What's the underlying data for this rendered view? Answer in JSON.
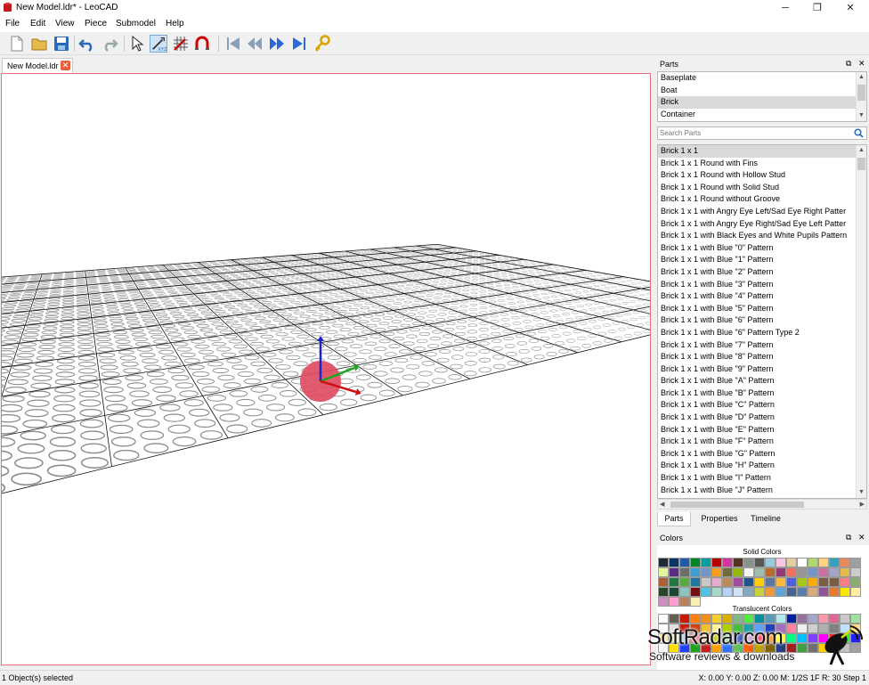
{
  "window": {
    "title": "New Model.ldr* - LeoCAD",
    "minimize": "─",
    "maximize": "❐",
    "close": "✕"
  },
  "menus": [
    "File",
    "Edit",
    "View",
    "Piece",
    "Submodel",
    "Help"
  ],
  "toolbar": {
    "icons": [
      "new-icon",
      "open-icon",
      "save-icon",
      "undo-icon",
      "redo-icon",
      "select-icon",
      "move-icon",
      "snap-grid-icon",
      "magnet-icon",
      "first-step-icon",
      "previous-step-icon",
      "next-step-icon",
      "last-step-icon",
      "key-icon"
    ]
  },
  "document_tab": {
    "label": "New Model.ldr",
    "close": "✕"
  },
  "parts_panel": {
    "title": "Parts",
    "categories": [
      "Baseplate",
      "Boat",
      "Brick",
      "Container"
    ],
    "selected_category": 2,
    "search_placeholder": "Search Parts",
    "parts": [
      "Brick  1 x  1",
      "Brick  1 x  1 Round with Fins",
      "Brick  1 x  1 Round with Hollow Stud",
      "Brick  1 x  1 Round with Solid Stud",
      "Brick  1 x  1 Round without Groove",
      "Brick  1 x  1 with Angry Eye Left/Sad Eye Right Patter",
      "Brick  1 x  1 with Angry Eye Right/Sad Eye Left Patter",
      "Brick  1 x  1 with Black Eyes and White Pupils Pattern",
      "Brick  1 x  1 with Blue \"0\" Pattern",
      "Brick  1 x  1 with Blue \"1\" Pattern",
      "Brick  1 x  1 with Blue \"2\" Pattern",
      "Brick  1 x  1 with Blue \"3\" Pattern",
      "Brick  1 x  1 with Blue \"4\" Pattern",
      "Brick  1 x  1 with Blue \"5\" Pattern",
      "Brick  1 x  1 with Blue \"6\" Pattern",
      "Brick  1 x  1 with Blue \"6\" Pattern Type 2",
      "Brick  1 x  1 with Blue \"7\" Pattern",
      "Brick  1 x  1 with Blue \"8\" Pattern",
      "Brick  1 x  1 with Blue \"9\" Pattern",
      "Brick  1 x  1 with Blue \"A\" Pattern",
      "Brick  1 x  1 with Blue \"B\" Pattern",
      "Brick  1 x  1 with Blue \"C\" Pattern",
      "Brick  1 x  1 with Blue \"D\" Pattern",
      "Brick  1 x  1 with Blue \"E\" Pattern",
      "Brick  1 x  1 with Blue \"F\" Pattern",
      "Brick  1 x  1 with Blue \"G\" Pattern",
      "Brick  1 x  1 with Blue \"H\" Pattern",
      "Brick  1 x  1 with Blue \"I\" Pattern",
      "Brick  1 x  1 with Blue \"J\" Pattern"
    ],
    "selected_part": 0,
    "tabs": [
      "Parts",
      "Properties",
      "Timeline"
    ],
    "active_tab": 0
  },
  "colors_panel": {
    "title": "Colors",
    "solid_label": "Solid Colors",
    "translucent_label": "Translucent Colors",
    "solid": [
      "#1b2a34",
      "#0a3463",
      "#1e5aa8",
      "#00852b",
      "#069d9f",
      "#b40000",
      "#d3359d",
      "#543324",
      "#8a928d",
      "#545955",
      "#97cbd9",
      "#f9c5e4",
      "#e4cd9e",
      "#ffffff",
      "#b2d76d",
      "#ffd67f",
      "#35a2bd",
      "#e98a5b",
      "#9ba19d",
      "#e2f99a",
      "#5b2a85",
      "#6c6e68",
      "#3ca0d4",
      "#7396c8",
      "#fa9c1c",
      "#726a3c",
      "#95b90c",
      "#f4f4f4",
      "#a0bcac",
      "#ba6a2c",
      "#923978",
      "#f2705e",
      "#969696",
      "#7396c8",
      "#c870a0",
      "#a5a5cb",
      "#e4b84d",
      "#cccccc",
      "#ab6038",
      "#237841",
      "#58ab41",
      "#1e78a0",
      "#c8c8c8",
      "#e4adc8",
      "#ba8b5a",
      "#a5499c",
      "#1f5390",
      "#ffcd02",
      "#6074a1",
      "#f8bb3d",
      "#4c61db",
      "#a5ca18",
      "#fcac00",
      "#7c5c45",
      "#7b5d41",
      "#ff7d86",
      "#88ad72",
      "#27462c",
      "#184632",
      "#8cc4c0",
      "#720e0f",
      "#4ec3e6",
      "#a8d7cc",
      "#b4d4f7",
      "#cfe2f7",
      "#85a9be",
      "#c7d23c",
      "#ef9a39",
      "#60a5d5",
      "#47638e",
      "#5b7fa8",
      "#daaa7a",
      "#8e5597",
      "#e57a2c",
      "#ffe600",
      "#ffeea4",
      "#cc8ec1",
      "#ff9ecd",
      "#bb805a",
      "#f9efb1"
    ],
    "translucent": [
      "#fcfcfc",
      "#635f52",
      "#c91a09",
      "#ff800d",
      "#f08f1c",
      "#f5cd2f",
      "#dab000",
      "#84b68d",
      "#56e646",
      "#008f9b",
      "#559ab7",
      "#aee9ef",
      "#0020a0",
      "#96709f",
      "#a5a5cb",
      "#fc97ac",
      "#df6695",
      "#c8c8c8",
      "#a0e3a0",
      "#ffffff",
      "#e0e0e0",
      "#c91a09",
      "#d04010",
      "#f0c030",
      "#fff0a0",
      "#b0d000",
      "#40c040",
      "#20a0a0",
      "#60a0ff",
      "#2040c0",
      "#a070c0",
      "#ff80a0",
      "#f0f0f0",
      "#d0d0d0",
      "#b0b0b0",
      "#808080",
      "#c0e0ff",
      "#ffe080",
      "#ffe0a0",
      "#e0f0a0",
      "#a0c0e0",
      "#e08080",
      "#f0b080",
      "#c0c000",
      "#80c080",
      "#4060c0",
      "#d0a0d0",
      "#ff4060",
      "#ff8000",
      "#ffff00",
      "#00ff80",
      "#00c0ff",
      "#8040ff",
      "#ff00ff",
      "#ff2020",
      "#20ff20",
      "#2020ff",
      "#f8f8f8",
      "#ffe000",
      "#2040ff",
      "#20a020",
      "#c02020",
      "#ffa000",
      "#3070ff",
      "#60c060",
      "#ff6000",
      "#c0a000",
      "#806000",
      "#204080",
      "#a02020",
      "#40a040",
      "#707070",
      "#ffd000",
      "#006080",
      "#c0c0c0",
      "#a0a0a0"
    ]
  },
  "status": {
    "left": "1 Object(s) selected",
    "right": "X: 0.00 Y: 0.00 Z: 0.00    M: 1/2S 1F R: 30   Step 1"
  },
  "watermark": {
    "brand": "SoftRadar.com",
    "tagline": "Software reviews & downloads"
  },
  "accent": "#e8707a"
}
